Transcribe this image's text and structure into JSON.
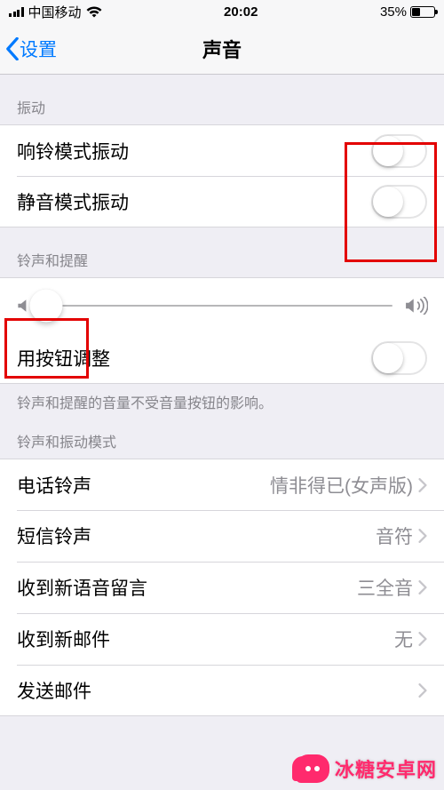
{
  "status_bar": {
    "carrier": "中国移动",
    "time": "20:02",
    "battery_pct": "35%"
  },
  "nav": {
    "back_label": "设置",
    "title": "声音"
  },
  "sections": {
    "vibration": {
      "header": "振动"
    },
    "ringtone_alert": {
      "header": "铃声和提醒",
      "footer": "铃声和提醒的音量不受音量按钮的影响。"
    },
    "patterns": {
      "header": "铃声和振动模式"
    }
  },
  "rows": {
    "vibrate_ring": {
      "label": "响铃模式振动",
      "on": false
    },
    "vibrate_silent": {
      "label": "静音模式振动",
      "on": false
    },
    "change_with_buttons": {
      "label": "用按钮调整",
      "on": false
    },
    "ringtone": {
      "label": "电话铃声",
      "value": "情非得已(女声版)"
    },
    "text_tone": {
      "label": "短信铃声",
      "value": "音符"
    },
    "voicemail": {
      "label": "收到新语音留言",
      "value": "三全音"
    },
    "mail": {
      "label": "收到新邮件",
      "value": "无"
    },
    "sent_mail": {
      "label": "发送邮件",
      "value": ""
    }
  },
  "slider": {
    "value_pct": 4
  },
  "watermark": {
    "text": "冰糖安卓网"
  }
}
